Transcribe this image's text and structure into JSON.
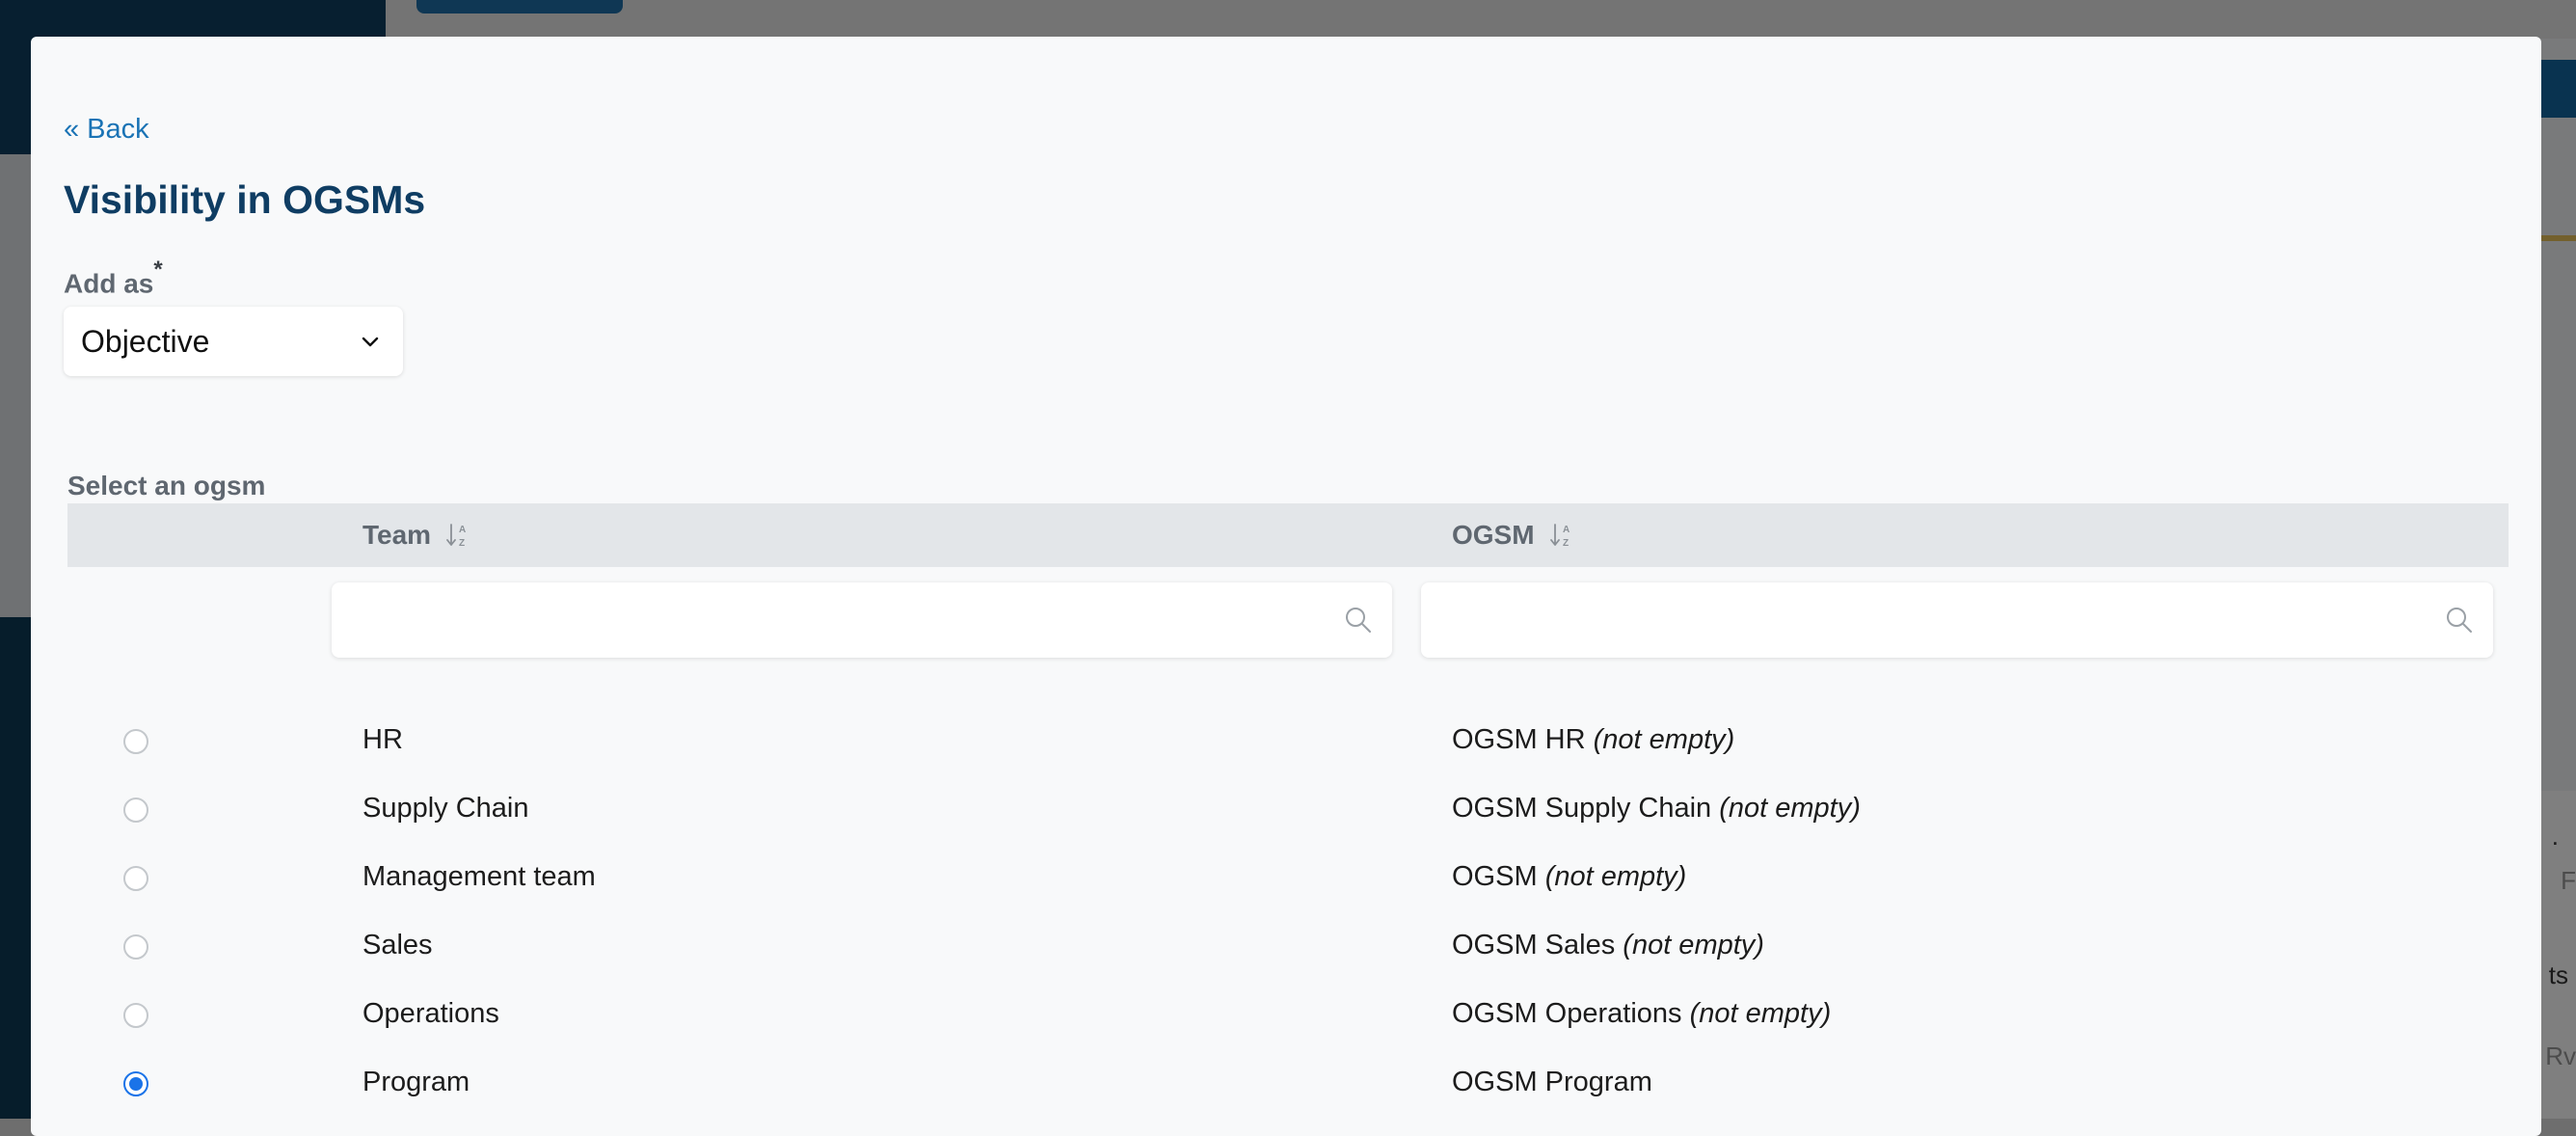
{
  "background": {
    "right_text_1": ".",
    "right_text_2": "F",
    "right_text_3": "ts",
    "right_text_4": "Rv"
  },
  "modal": {
    "back_label": "« Back",
    "title": "Visibility in OGSMs",
    "add_as_label": "Add as",
    "required_mark": "*",
    "add_as_value": "Objective",
    "select_label": "Select an ogsm",
    "columns": {
      "team": "Team",
      "ogsm": "OGSM"
    },
    "filters": {
      "team_value": "",
      "ogsm_value": ""
    },
    "rows": [
      {
        "team": "HR",
        "ogsm": "OGSM HR",
        "note": "(not empty)",
        "selected": false
      },
      {
        "team": "Supply Chain",
        "ogsm": "OGSM Supply Chain",
        "note": "(not empty)",
        "selected": false
      },
      {
        "team": "Management team",
        "ogsm": "OGSM",
        "note": "(not empty)",
        "selected": false
      },
      {
        "team": "Sales",
        "ogsm": "OGSM Sales",
        "note": "(not empty)",
        "selected": false
      },
      {
        "team": "Operations",
        "ogsm": "OGSM Operations",
        "note": "(not empty)",
        "selected": false
      },
      {
        "team": "Program",
        "ogsm": "OGSM Program",
        "note": "",
        "selected": true
      }
    ]
  },
  "colors": {
    "accent": "#1a73e8",
    "title": "#0f3d63",
    "link": "#1a73b5"
  },
  "icons": {
    "select": "chevron-down-icon",
    "sort": "sort-alpha-icon",
    "filter": "search-icon"
  }
}
